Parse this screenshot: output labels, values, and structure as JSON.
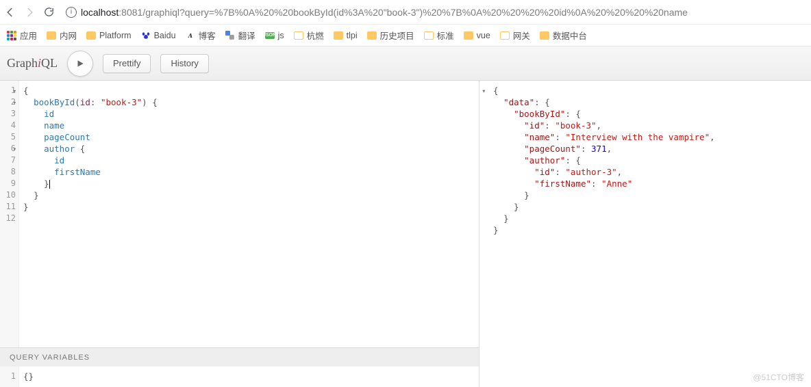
{
  "browser": {
    "url_host": "localhost",
    "url_port": ":8081",
    "url_path": "/graphiql?query=%7B%0A%20%20bookById(id%3A%20\"book-3\")%20%7B%0A%20%20%20%20id%0A%20%20%20%20name"
  },
  "bookmarks": {
    "apps": "应用",
    "items": [
      {
        "label": "内网",
        "type": "folder"
      },
      {
        "label": "Platform",
        "type": "folder"
      },
      {
        "label": "Baidu",
        "type": "baidu"
      },
      {
        "label": "博客",
        "type": "blog"
      },
      {
        "label": "翻译",
        "type": "translate"
      },
      {
        "label": "js",
        "type": "json"
      },
      {
        "label": "杭燃",
        "type": "folder-o"
      },
      {
        "label": "tlpi",
        "type": "folder"
      },
      {
        "label": "历史项目",
        "type": "folder"
      },
      {
        "label": "标准",
        "type": "folder-o"
      },
      {
        "label": "vue",
        "type": "folder"
      },
      {
        "label": "网关",
        "type": "folder-o"
      },
      {
        "label": "数据中台",
        "type": "folder"
      }
    ]
  },
  "toolbar": {
    "title_prefix": "Graph",
    "title_i": "i",
    "title_suffix": "QL",
    "prettify": "Prettify",
    "history": "History"
  },
  "query": {
    "lines": {
      "l1": "{",
      "l2_field": "bookById",
      "l2_arg": "id",
      "l2_str": "\"book-3\"",
      "l3_field": "id",
      "l4_field": "name",
      "l5_field": "pageCount",
      "l6_field": "author",
      "l7_field": "id",
      "l8_field": "firstName"
    },
    "vars_label": "QUERY VARIABLES",
    "vars_value": "{}"
  },
  "result": {
    "data_key": "\"data\"",
    "book_key": "\"bookById\"",
    "id_key": "\"id\"",
    "id_val": "\"book-3\"",
    "name_key": "\"name\"",
    "name_val": "\"Interview with the vampire\"",
    "pc_key": "\"pageCount\"",
    "pc_val": "371",
    "author_key": "\"author\"",
    "aid_key": "\"id\"",
    "aid_val": "\"author-3\"",
    "fn_key": "\"firstName\"",
    "fn_val": "\"Anne\""
  },
  "watermark": "@51CTO博客"
}
